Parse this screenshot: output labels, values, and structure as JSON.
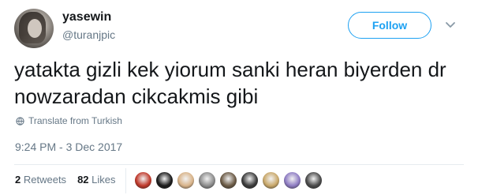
{
  "user": {
    "display_name": "yasewin",
    "handle": "@turanjpic"
  },
  "follow_button": {
    "label": "Follow"
  },
  "tweet": {
    "text": "yatakta gizli kek yiorum sanki heran biyerden dr nowzaradan cikcakmis gibi",
    "translate_label": "Translate from Turkish",
    "timestamp": "9:24 PM - 3 Dec 2017"
  },
  "stats": {
    "retweets_count": "2",
    "retweets_label": "Retweets",
    "likes_count": "82",
    "likes_label": "Likes"
  },
  "likers": [
    {
      "name": "liker-1",
      "color": "#c0392b"
    },
    {
      "name": "liker-2",
      "color": "#1b1b1b"
    },
    {
      "name": "liker-3",
      "color": "#d9b48a"
    },
    {
      "name": "liker-4",
      "color": "#8c8c8c"
    },
    {
      "name": "liker-5",
      "color": "#6b5a45"
    },
    {
      "name": "liker-6",
      "color": "#3b3b3b"
    },
    {
      "name": "liker-7",
      "color": "#c9a86a"
    },
    {
      "name": "liker-8",
      "color": "#8e7cc3"
    },
    {
      "name": "liker-9",
      "color": "#4a4a4a"
    }
  ],
  "colors": {
    "accent": "#1da1f2",
    "secondary_text": "#657786",
    "primary_text": "#14171a"
  }
}
